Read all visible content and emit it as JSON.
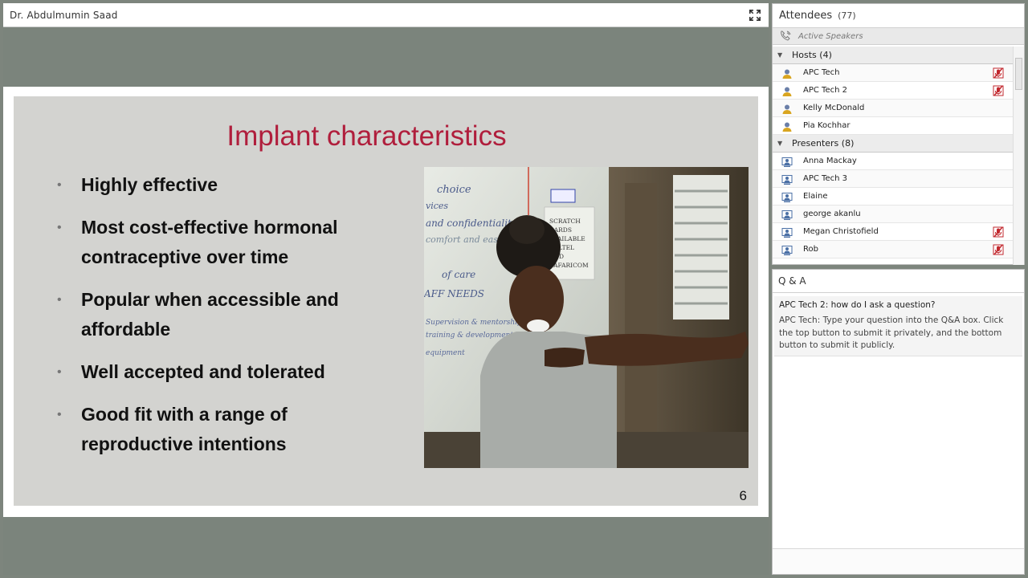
{
  "presenter": {
    "name": "Dr. Abdulmumin Saad",
    "fullscreen_icon": "fullscreen-icon"
  },
  "slide": {
    "title": "Implant characteristics",
    "bullets": [
      "Highly effective",
      "Most cost-effective hormonal contraceptive over time",
      "Popular when accessible and affordable",
      "Well accepted and tolerated",
      "Good fit with a range of reproductive intentions"
    ],
    "page_number": "6",
    "photo_board_text": {
      "line1": "choice",
      "line2": "vices",
      "line3": "and confidentiality",
      "line4": "comfort and ease",
      "line5": "of care",
      "line6": "AFF NEEDS",
      "line7": "Supervision & mentorship",
      "line8": "training & development",
      "line9": "equipment",
      "poster": "SCRATCH CARDS AVAILABLE CELTEL AND SAFARICOM"
    },
    "title_color": "#b01e3c",
    "background_color": "#d3d3d0"
  },
  "attendees": {
    "title": "Attendees",
    "count": "(77)",
    "active_speakers_label": "Active Speakers",
    "groups": [
      {
        "label": "Hosts (4)",
        "people": [
          {
            "name": "APC Tech",
            "mic_muted": true
          },
          {
            "name": "APC Tech 2",
            "mic_muted": true
          },
          {
            "name": "Kelly McDonald",
            "mic_muted": false
          },
          {
            "name": "Pia Kochhar",
            "mic_muted": false
          }
        ]
      },
      {
        "label": "Presenters (8)",
        "people": [
          {
            "name": "Anna Mackay",
            "mic_muted": false
          },
          {
            "name": "APC Tech 3",
            "mic_muted": false
          },
          {
            "name": "Elaine",
            "mic_muted": false
          },
          {
            "name": "george akanlu",
            "mic_muted": false
          },
          {
            "name": "Megan Christofield",
            "mic_muted": true
          },
          {
            "name": "Rob",
            "mic_muted": true
          }
        ]
      }
    ]
  },
  "qa": {
    "title": "Q & A",
    "entries": [
      {
        "question": "APC Tech 2: how do I ask a question?",
        "answer": "APC Tech: Type your question into the Q&A box. Click the top button to submit it privately, and the bottom button to submit it publicly."
      }
    ]
  },
  "colors": {
    "background": "#7d857d",
    "mic_muted_red": "#c1272d",
    "host_icon_gold": "#d9a520",
    "presenter_icon_blue": "#4a6fa5"
  }
}
